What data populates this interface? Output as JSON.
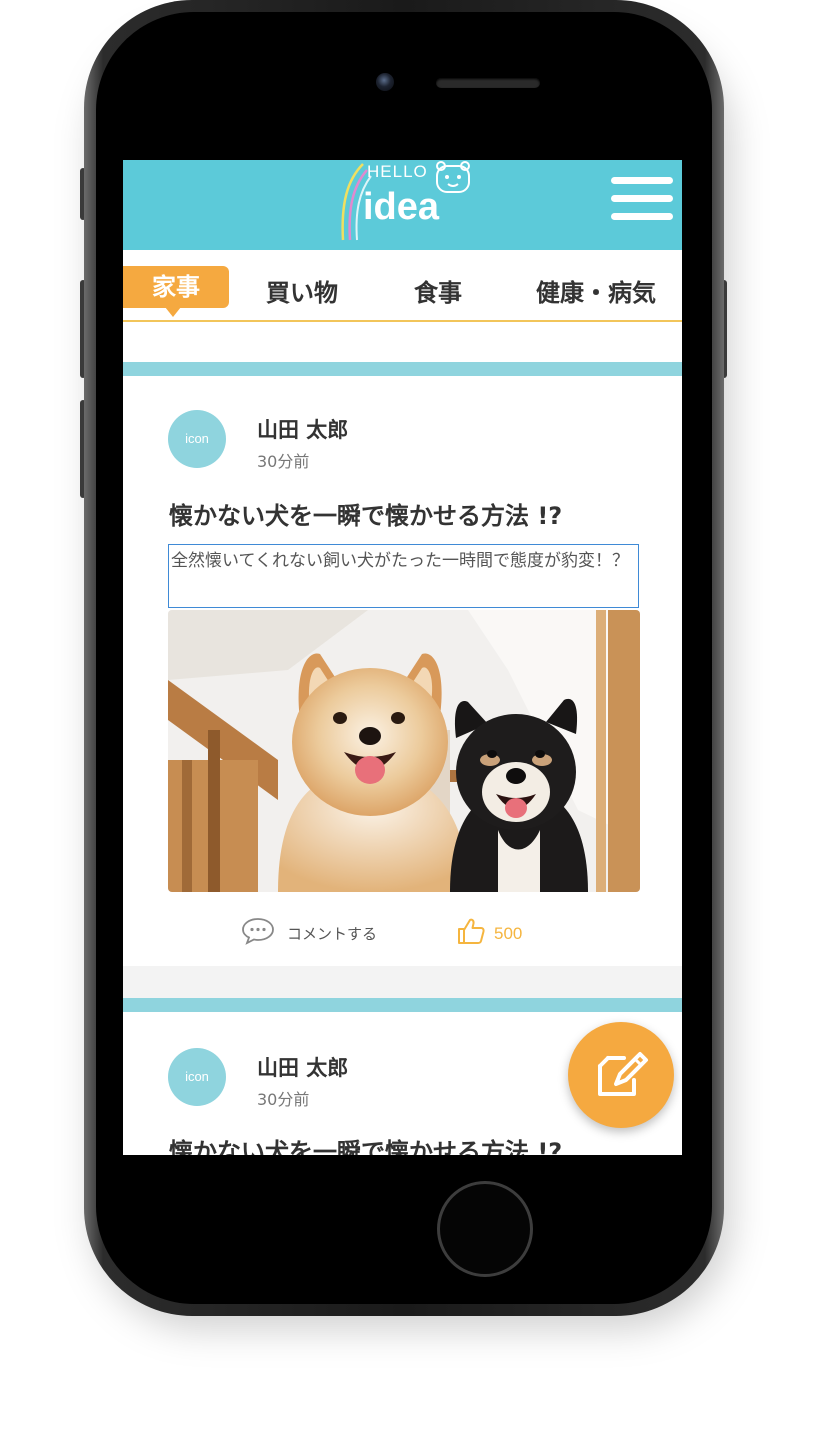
{
  "app": {
    "logo_hello": "HELLO",
    "logo_idea": "idea",
    "menu_icon": "hamburger-menu-icon"
  },
  "colors": {
    "header": "#5ccad9",
    "accent": "#f5a940",
    "card_band": "#8fd4de",
    "like": "#f5b53f"
  },
  "tabs": [
    {
      "label": "家事",
      "active": true
    },
    {
      "label": "買い物",
      "active": false
    },
    {
      "label": "食事",
      "active": false
    },
    {
      "label": "健康・病気",
      "active": false
    }
  ],
  "posts": [
    {
      "avatar_text": "icon",
      "author": "山田 太郎",
      "time": "30分前",
      "title": "懐かない犬を一瞬で懐かせる方法 !?",
      "description": "全然懐いてくれない飼い犬がたった一時間で態度が豹変！？",
      "comment_label": "コメントする",
      "like_count": "500"
    },
    {
      "avatar_text": "icon",
      "author": "山田 太郎",
      "time": "30分前",
      "title": "懐かない犬を一瞬で懐かせる方法 !?"
    }
  ],
  "fab_icon": "compose-icon"
}
